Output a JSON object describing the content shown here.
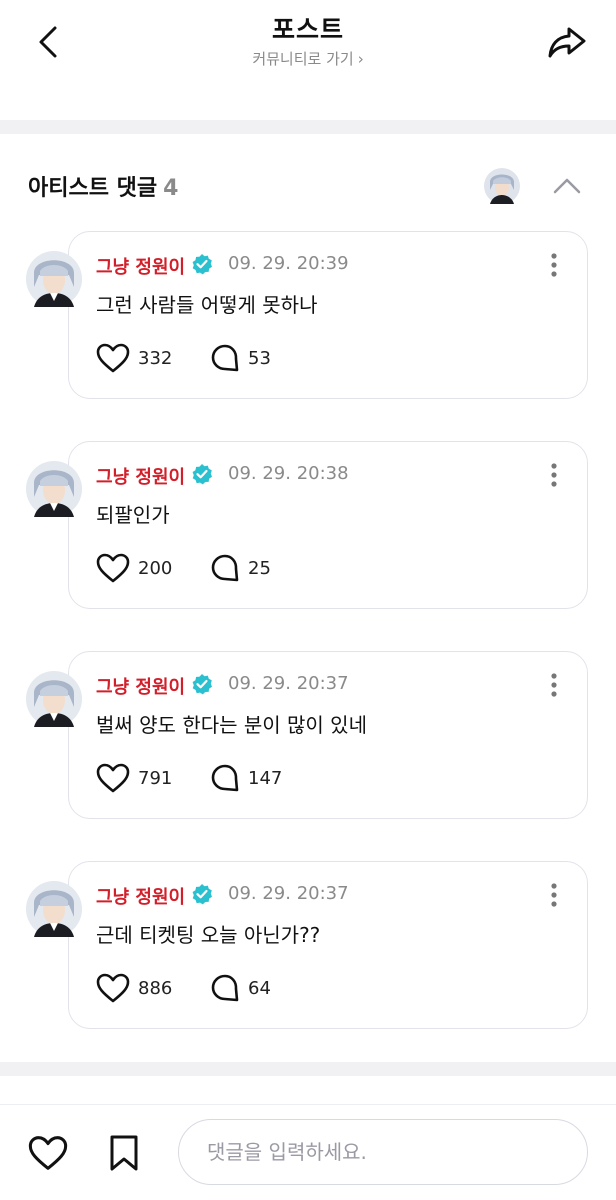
{
  "header": {
    "title": "포스트",
    "subtitle": "커뮤니티로 가기",
    "subtitle_chevron": "›"
  },
  "section": {
    "title": "아티스트 댓글",
    "count": "4"
  },
  "comments": [
    {
      "author": "그냥 정원이",
      "time": "09. 29. 20:39",
      "text": "그런 사람들 어떻게 못하나",
      "likes": "332",
      "replies": "53"
    },
    {
      "author": "그냥 정원이",
      "time": "09. 29. 20:38",
      "text": "되팔인가",
      "likes": "200",
      "replies": "25"
    },
    {
      "author": "그냥 정원이",
      "time": "09. 29. 20:37",
      "text": "벌써 양도 한다는 분이 많이 있네",
      "likes": "791",
      "replies": "147"
    },
    {
      "author": "그냥 정원이",
      "time": "09. 29. 20:37",
      "text": "근데 티켓팅 오늘 아닌가??",
      "likes": "886",
      "replies": "64"
    }
  ],
  "bottom": {
    "input_placeholder": "댓글을 입력하세요."
  },
  "colors": {
    "author_name": "#d21f2a",
    "verified_badge": "#2bc0cf",
    "separator": "#f1f1f3",
    "bubble_border": "#e2e3ea"
  },
  "icons": [
    "back-arrow-icon",
    "share-arrow-icon",
    "chevron-up-icon",
    "verified-badge-icon",
    "more-dots-icon",
    "heart-icon",
    "speech-bubble-icon",
    "bookmark-icon"
  ]
}
